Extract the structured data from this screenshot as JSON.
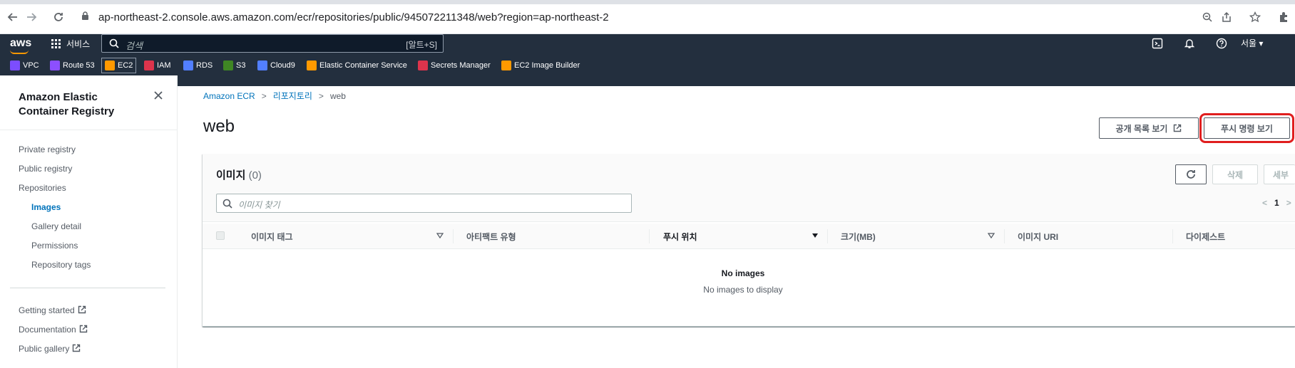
{
  "browser": {
    "url": "ap-northeast-2.console.aws.amazon.com/ecr/repositories/public/945072211348/web?region=ap-northeast-2"
  },
  "aws_nav": {
    "logo": "aws",
    "services_label": "서비스",
    "search_placeholder": "검색",
    "search_shortcut": "[알트+S]",
    "region": "서울 ▾",
    "favorites": [
      {
        "label": "VPC",
        "color": "#7c4dff"
      },
      {
        "label": "Route 53",
        "color": "#8c4fff"
      },
      {
        "label": "EC2",
        "color": "#ff9900"
      },
      {
        "label": "IAM",
        "color": "#dd344c"
      },
      {
        "label": "RDS",
        "color": "#527fff"
      },
      {
        "label": "S3",
        "color": "#3f8624"
      },
      {
        "label": "Cloud9",
        "color": "#527fff"
      },
      {
        "label": "Elastic Container Service",
        "color": "#ff9900"
      },
      {
        "label": "Secrets Manager",
        "color": "#dd344c"
      },
      {
        "label": "EC2 Image Builder",
        "color": "#ff9900"
      }
    ]
  },
  "sidebar": {
    "title": "Amazon Elastic Container Registry",
    "items": [
      {
        "label": "Private registry"
      },
      {
        "label": "Public registry"
      },
      {
        "label": "Repositories"
      },
      {
        "label": "Images"
      },
      {
        "label": "Gallery detail"
      },
      {
        "label": "Permissions"
      },
      {
        "label": "Repository tags"
      }
    ],
    "footer_links": [
      {
        "label": "Getting started"
      },
      {
        "label": "Documentation"
      },
      {
        "label": "Public gallery"
      }
    ]
  },
  "breadcrumb": {
    "items": [
      "Amazon ECR",
      "리포지토리",
      "web"
    ]
  },
  "page": {
    "title": "web",
    "view_public_listing": "공개 목록 보기",
    "view_push_commands": "푸시 명령 보기"
  },
  "images_panel": {
    "title": "이미지",
    "count": "(0)",
    "delete_label": "삭제",
    "details_label": "세부",
    "search_placeholder": "이미지 찾기",
    "page_number": "1",
    "columns": [
      "이미지 태그",
      "아티팩트 유형",
      "푸시 위치",
      "크기(MB)",
      "이미지 URI",
      "다이제스트"
    ],
    "empty_title": "No images",
    "empty_subtitle": "No images to display"
  }
}
